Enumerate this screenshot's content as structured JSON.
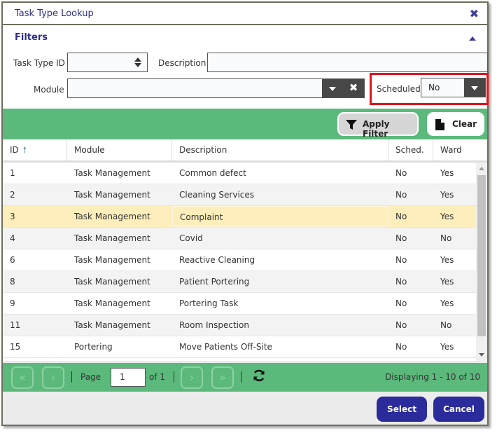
{
  "dialog": {
    "title": "Task Type Lookup",
    "close_icon": "close-icon"
  },
  "filters": {
    "heading": "Filters",
    "collapse_icon": "caret-up-icon",
    "task_type_id": {
      "label": "Task Type ID",
      "value": ""
    },
    "description": {
      "label": "Description",
      "value": ""
    },
    "module": {
      "label": "Module",
      "value": ""
    },
    "scheduled": {
      "label": "Scheduled",
      "value": "No"
    }
  },
  "toolbar": {
    "apply_filter": "Apply Filter",
    "clear": "Clear"
  },
  "grid": {
    "columns": [
      {
        "label": "ID",
        "sort": "ascending"
      },
      {
        "label": "Module"
      },
      {
        "label": "Description"
      },
      {
        "label": "Sched."
      },
      {
        "label": "Ward"
      }
    ],
    "rows": [
      {
        "id": "1",
        "module": "Task Management",
        "description": "Common defect",
        "sched": "No",
        "ward": "Yes"
      },
      {
        "id": "2",
        "module": "Task Management",
        "description": "Cleaning Services",
        "sched": "No",
        "ward": "Yes"
      },
      {
        "id": "3",
        "module": "Task Management",
        "description": "Complaint",
        "sched": "No",
        "ward": "Yes",
        "selected": true
      },
      {
        "id": "4",
        "module": "Task Management",
        "description": "Covid",
        "sched": "No",
        "ward": "No"
      },
      {
        "id": "6",
        "module": "Task Management",
        "description": "Reactive Cleaning",
        "sched": "No",
        "ward": "Yes"
      },
      {
        "id": "8",
        "module": "Task Management",
        "description": "Patient Portering",
        "sched": "No",
        "ward": "Yes"
      },
      {
        "id": "9",
        "module": "Task Management",
        "description": "Portering Task",
        "sched": "No",
        "ward": "Yes"
      },
      {
        "id": "11",
        "module": "Task Management",
        "description": "Room Inspection",
        "sched": "No",
        "ward": "No"
      },
      {
        "id": "15",
        "module": "Portering",
        "description": "Move Patients Off-Site",
        "sched": "No",
        "ward": "Yes"
      }
    ]
  },
  "pager": {
    "page_label": "Page",
    "page_value": "1",
    "of_label": "of 1",
    "display_text": "Displaying 1 - 10 of 10",
    "first_glyph": "«",
    "prev_glyph": "‹",
    "next_glyph": "›",
    "last_glyph": "»"
  },
  "footer": {
    "select": "Select",
    "cancel": "Cancel"
  },
  "colors": {
    "accent_green": "#5cb97c",
    "primary_button": "#2b2b9c",
    "title_text": "#2e2e8a",
    "selected_row": "#fdeebb",
    "highlight_border": "#e0141e"
  }
}
